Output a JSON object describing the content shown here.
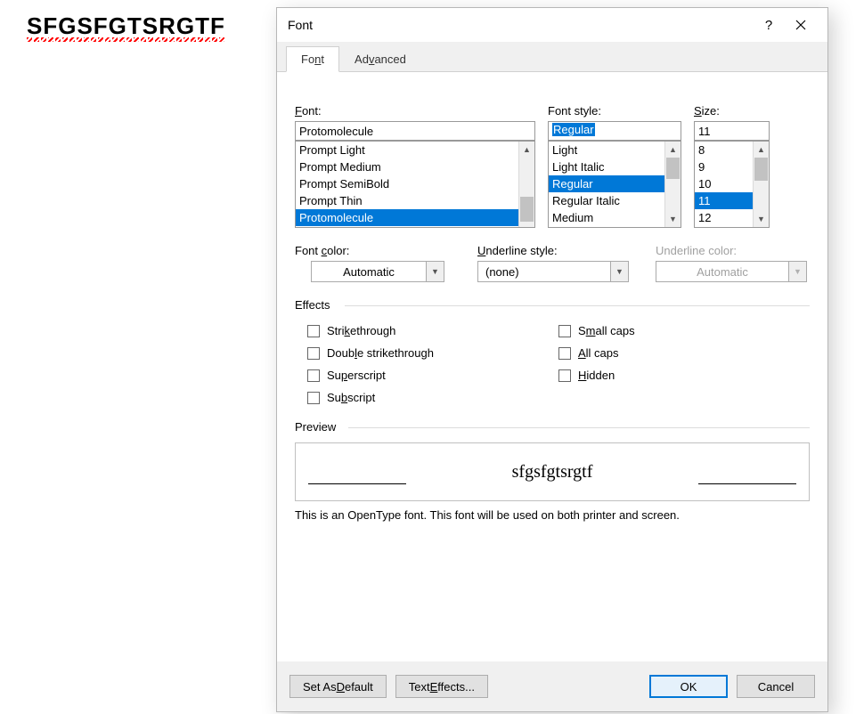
{
  "document": {
    "sample_text": "SFGSFGTSRGTF"
  },
  "dialog": {
    "title": "Font",
    "tabs": [
      {
        "label_pre": "Fo",
        "label_u": "n",
        "label_post": "t"
      },
      {
        "label_pre": "Ad",
        "label_u": "v",
        "label_post": "anced"
      }
    ],
    "font": {
      "label_u": "F",
      "label_post": "ont:",
      "value": "Protomolecule",
      "list": [
        "Prompt Light",
        "Prompt Medium",
        "Prompt SemiBold",
        "Prompt Thin",
        "Protomolecule"
      ]
    },
    "style": {
      "label": "Font style:",
      "value": "Regular",
      "list": [
        "Light",
        "Light Italic",
        "Regular",
        "Regular Italic",
        "Medium"
      ]
    },
    "size": {
      "label_u": "S",
      "label_post": "ize:",
      "value": "11",
      "list": [
        "8",
        "9",
        "10",
        "11",
        "12"
      ]
    },
    "color": {
      "label_pre": "Font ",
      "label_u": "c",
      "label_post": "olor:",
      "value": "Automatic"
    },
    "ustyle": {
      "label_u": "U",
      "label_post": "nderline style:",
      "value": "(none)"
    },
    "ucolor": {
      "label": "Underline color:",
      "value": "Automatic"
    },
    "effects": {
      "section_label": "Effects",
      "left": [
        {
          "pre": "Stri",
          "u": "k",
          "post": "ethrough"
        },
        {
          "pre": "Doub",
          "u": "l",
          "post": "e strikethrough"
        },
        {
          "pre": "Su",
          "u": "p",
          "post": "erscript"
        },
        {
          "pre": "Su",
          "u": "b",
          "post": "script"
        }
      ],
      "right": [
        {
          "pre": "S",
          "u": "m",
          "post": "all caps"
        },
        {
          "pre": "",
          "u": "A",
          "post": "ll caps"
        },
        {
          "pre": "",
          "u": "H",
          "post": "idden"
        }
      ]
    },
    "preview": {
      "section_label": "Preview",
      "sample": "sfgsfgtsrgtf",
      "note": "This is an OpenType font. This font will be used on both printer and screen."
    },
    "buttons": {
      "set_default_pre": "Set As ",
      "set_default_u": "D",
      "set_default_post": "efault",
      "text_effects_pre": "Text ",
      "text_effects_u": "E",
      "text_effects_post": "ffects...",
      "ok": "OK",
      "cancel": "Cancel"
    }
  }
}
